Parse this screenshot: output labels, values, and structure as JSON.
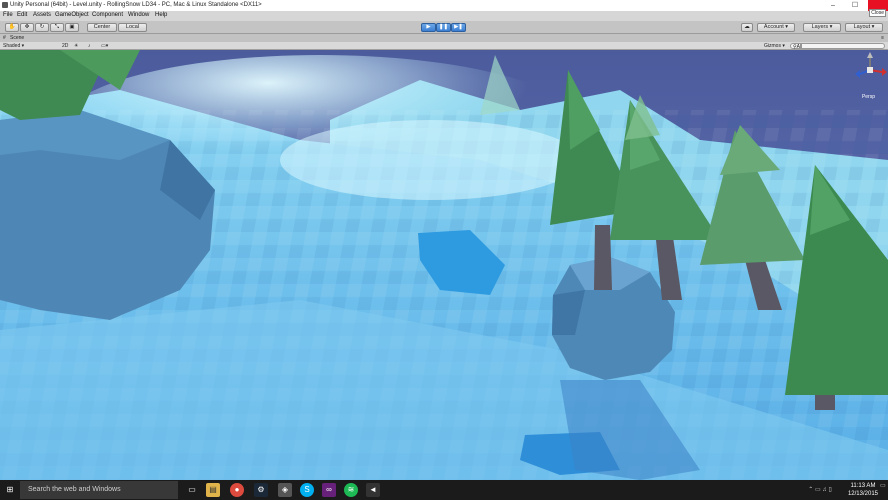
{
  "window": {
    "title": "Unity Personal (64bit) - Level.unity - RollingSnow LD34 - PC, Mac & Linux Standalone <DX11>",
    "close_tooltip": "Close",
    "minimize": "–",
    "maximize": "☐"
  },
  "menu": [
    "File",
    "Edit",
    "Assets",
    "GameObject",
    "Component",
    "Window",
    "Help"
  ],
  "toolbar": {
    "pivot_label": "Center",
    "space_label": "Local",
    "account_label": "Account",
    "layers_label": "Layers",
    "layout_label": "Layout"
  },
  "scene": {
    "tab_label": "Scene",
    "shading_mode": "Shaded",
    "mode_2d": "2D",
    "gizmos_label": "Gizmos",
    "search_placeholder": "All",
    "persp_label": "Persp"
  },
  "taskbar": {
    "search_placeholder": "Search the web and Windows",
    "time": "11:13 AM",
    "date": "12/13/2015"
  },
  "colors": {
    "sky": "#5a6aa8",
    "snow": "#6cc0ee",
    "accent": "#3b7fd3"
  }
}
